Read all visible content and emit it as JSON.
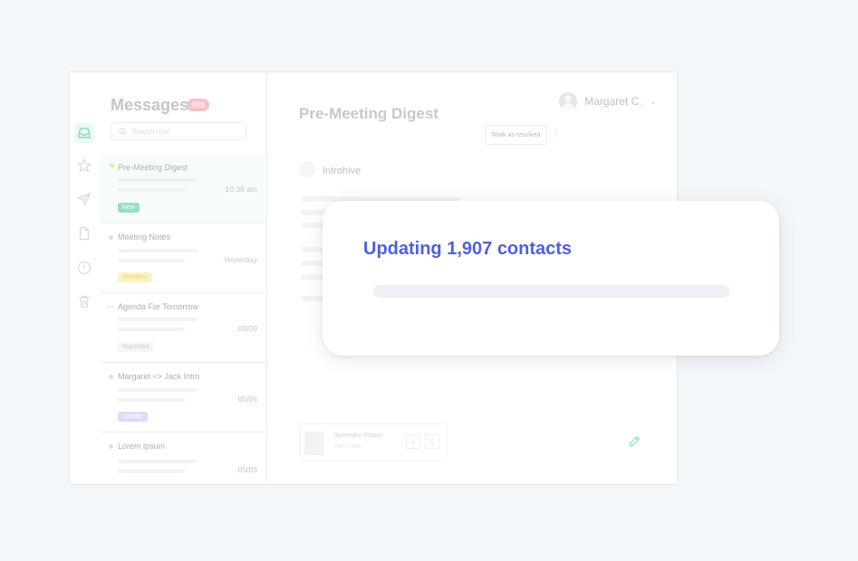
{
  "sidebar": {
    "icons": [
      "inbox-icon",
      "star-icon",
      "send-icon",
      "file-icon",
      "alert-icon",
      "trash-icon"
    ]
  },
  "list": {
    "title": "Messages",
    "count": "999",
    "search_placeholder": "Search mail",
    "items": [
      {
        "subject": "Pre-Meeting Digest",
        "time": "10:38 am",
        "tag": "New",
        "marker": "star"
      },
      {
        "subject": "Meeting Notes",
        "time": "Yesterday",
        "tag": "Attention",
        "marker": "dot"
      },
      {
        "subject": "Agenda For Tomorrow",
        "time": "05/09",
        "tag": "Important",
        "marker": "reply"
      },
      {
        "subject": "Margaret <> Jack Intro",
        "time": "05/06",
        "tag": "Update",
        "marker": "dot"
      },
      {
        "subject": "Lorem ipsum",
        "time": "05/03",
        "tag": "",
        "marker": "dot"
      }
    ]
  },
  "reader": {
    "title": "Pre-Meeting Digest",
    "user": "Margaret C.",
    "resolve_label": "Mark as resolved",
    "sender": "Introhive",
    "attachment": {
      "name": "Summary Report",
      "meta": "PDF • 1.4MB"
    }
  },
  "modal": {
    "title": "Updating 1,907 contacts",
    "progress": 0
  },
  "colors": {
    "accent": "#4f5fe0",
    "green": "#52c79a",
    "badge": "#f2a1aa"
  }
}
